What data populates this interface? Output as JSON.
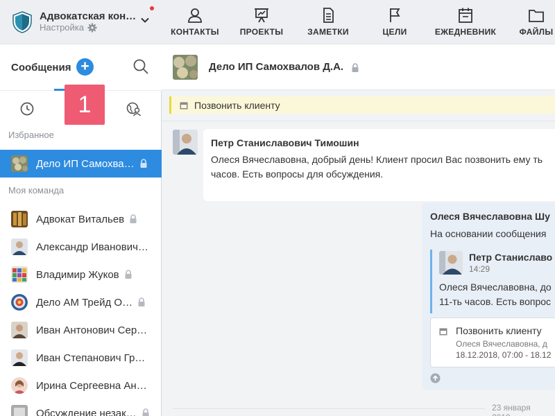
{
  "org": {
    "name": "Адвокатская кон…",
    "settings_label": "Настройка"
  },
  "topnav": [
    {
      "label": "КОНТАКТЫ",
      "icon": "person-icon"
    },
    {
      "label": "ПРОЕКТЫ",
      "icon": "presentation-icon"
    },
    {
      "label": "ЗАМЕТКИ",
      "icon": "note-icon"
    },
    {
      "label": "ЦЕЛИ",
      "icon": "flag-icon"
    },
    {
      "label": "ЕЖЕДНЕВНИК",
      "icon": "calendar-icon"
    },
    {
      "label": "ФАЙЛЫ",
      "icon": "folder-icon"
    }
  ],
  "sidebar": {
    "title": "Сообщения",
    "add_symbol": "+",
    "callout_number": "1",
    "favorites_label": "Избранное",
    "team_label": "Моя команда",
    "favorites": [
      {
        "name": "Дело ИП Самохва…",
        "locked": true,
        "active": true
      }
    ],
    "team": [
      {
        "name": "Адвокат Витальев",
        "locked": true
      },
      {
        "name": "Александр Иванович…",
        "locked": false
      },
      {
        "name": "Владимир Жуков",
        "locked": true
      },
      {
        "name": "Дело АМ Трейд О…",
        "locked": true
      },
      {
        "name": "Иван Антонович Сер…",
        "locked": false
      },
      {
        "name": "Иван Степанович Гр…",
        "locked": false
      },
      {
        "name": "Ирина Сергеевна Ан…",
        "locked": false
      },
      {
        "name": "Обсуждение незак…",
        "locked": true
      }
    ]
  },
  "chat": {
    "title": "Дело ИП Самохвалов Д.А.",
    "pinned": "Позвонить клиенту",
    "message1": {
      "author": "Петр Станиславович Тимошин",
      "text": "Олеся Вячеславовна, добрый день! Клиент просил Вас позвонить ему ть часов. Есть вопросы для обсуждения."
    },
    "message2": {
      "author": "Олеся Вячеславовна Шу",
      "text": "На основании сообщения",
      "quote_author": "Петр Станиславо",
      "quote_time": "14:29",
      "quote_line1": "Олеся Вячеславовна, до",
      "quote_line2": "11-ть часов. Есть вопрос",
      "task_title": "Позвонить клиенту",
      "task_sub": "Олеся Вячеславовна, д",
      "task_date": "18.12.2018, 07:00 - 18.12"
    },
    "date_separator": "23 января 2019"
  },
  "colors": {
    "accent": "#2d8be0",
    "callout": "#ef5b73",
    "pin": "#fbf8d9"
  }
}
